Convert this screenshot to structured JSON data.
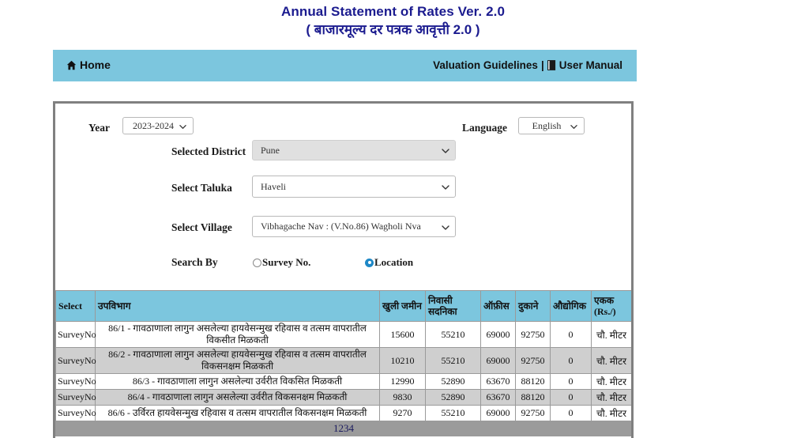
{
  "header": {
    "title_en": "Annual Statement of Rates Ver. 2.0",
    "title_mr": "( बाजारमूल्य दर पत्रक आवृत्ती 2.0 )",
    "accent_color": "#1b1b8f"
  },
  "nav": {
    "home_label": "Home",
    "home_icon": "home-icon",
    "valuation_label": "Valuation Guidelines",
    "separator": "|",
    "manual_icon": "book-icon",
    "manual_label": "User Manual",
    "background_color": "#7cc6de"
  },
  "form": {
    "year_label": "Year",
    "year_value": "2023-2024",
    "language_label": "Language",
    "language_value": "English",
    "district_label": "Selected District",
    "district_value": "Pune",
    "taluka_label": "Select Taluka",
    "taluka_value": "Haveli",
    "village_label": "Select Village",
    "village_value": "Vibhagache Nav : (V.No.86) Wagholi Nva",
    "search_by_label": "Search By",
    "radio_survey_label": "Survey No.",
    "radio_location_label": "Location",
    "radio_selected": "Location",
    "radio_accent_color": "#1e88c7"
  },
  "table": {
    "headers": {
      "select": "Select",
      "subdivision": "उपविभाग",
      "open_land": "खुली जमीन",
      "residential": "निवासी सदनिका",
      "office": "ऑफ़ीस",
      "shops": "दुकाने",
      "industrial": "औद्योगिक",
      "unit": "एकक (Rs./)"
    },
    "header_color": "#7cc6de",
    "rows": [
      {
        "select": "SurveyNo",
        "subdivision": "86/1 - गावठाणाला लागुन असलेल्या हायवेसन्मुख रहिवास व तत्सम वापरातील विकसीत मिळकती",
        "open_land": "15600",
        "residential": "55210",
        "office": "69000",
        "shops": "92750",
        "industrial": "0",
        "unit": "चौ. मीटर"
      },
      {
        "select": "SurveyNo",
        "subdivision": "86/2 - गावठाणाला लागुन असलेल्या हायवेसन्मुख रहिवास व तत्सम वापरातील विकसनक्षम मिळकती",
        "open_land": "10210",
        "residential": "55210",
        "office": "69000",
        "shops": "92750",
        "industrial": "0",
        "unit": "चौ. मीटर"
      },
      {
        "select": "SurveyNo",
        "subdivision": "86/3 - गावठाणाला लागुन असलेल्या उर्वरीत विकसित मिळकती",
        "open_land": "12990",
        "residential": "52890",
        "office": "63670",
        "shops": "88120",
        "industrial": "0",
        "unit": "चौ. मीटर"
      },
      {
        "select": "SurveyNo",
        "subdivision": "86/4 - गावठाणाला लागुन असलेल्या उर्वरीत विकसनक्षम मिळकती",
        "open_land": "9830",
        "residential": "52890",
        "office": "63670",
        "shops": "88120",
        "industrial": "0",
        "unit": "चौ. मीटर"
      },
      {
        "select": "SurveyNo",
        "subdivision": "86/6 - उर्विरत हायवेसन्मुख रहिवास व तत्सम वापरातील विकसनक्षम मिळकती",
        "open_land": "9270",
        "residential": "55210",
        "office": "69000",
        "shops": "92750",
        "industrial": "0",
        "unit": "चौ. मीटर"
      }
    ],
    "pagination": [
      "1",
      "2",
      "3",
      "4"
    ],
    "pagination_bg": "#9b9b9b"
  }
}
